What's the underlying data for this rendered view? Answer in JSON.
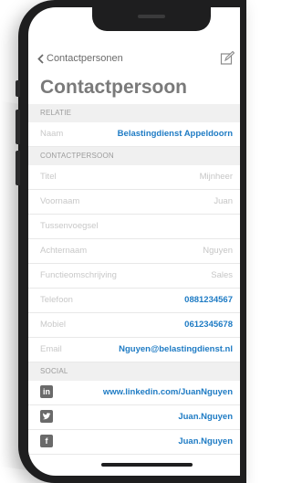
{
  "nav": {
    "back_label": "Contactpersonen"
  },
  "title": "Contactpersoon",
  "sections": {
    "relatie": "RELATIE",
    "contactpersoon": "CONTACTPERSOON",
    "social": "SOCIAL"
  },
  "relatie": {
    "label": "Naam",
    "value": "Belastingdienst Appeldoorn"
  },
  "contact": [
    {
      "label": "Titel",
      "value": "Mijnheer"
    },
    {
      "label": "Voornaam",
      "value": "Juan"
    },
    {
      "label": "Tussenvoegsel",
      "value": ""
    },
    {
      "label": "Achternaam",
      "value": "Nguyen"
    },
    {
      "label": "Functieomschrijving",
      "value": "Sales"
    },
    {
      "label": "Telefoon",
      "value": "0881234567"
    },
    {
      "label": "Mobiel",
      "value": "0612345678"
    },
    {
      "label": "Email",
      "value": "Nguyen@belastingdienst.nl"
    }
  ],
  "social": [
    {
      "icon": "linkedin-icon",
      "glyph": "in",
      "value": "www.linkedin.com/JuanNguyen"
    },
    {
      "icon": "twitter-icon",
      "glyph": "t",
      "value": "Juan.Nguyen"
    },
    {
      "icon": "facebook-icon",
      "glyph": "f",
      "value": "Juan.Nguyen"
    }
  ],
  "colors": {
    "link": "#1e7bc4",
    "section_bg": "#f0f0f0",
    "phone": "#1e1e1f"
  }
}
